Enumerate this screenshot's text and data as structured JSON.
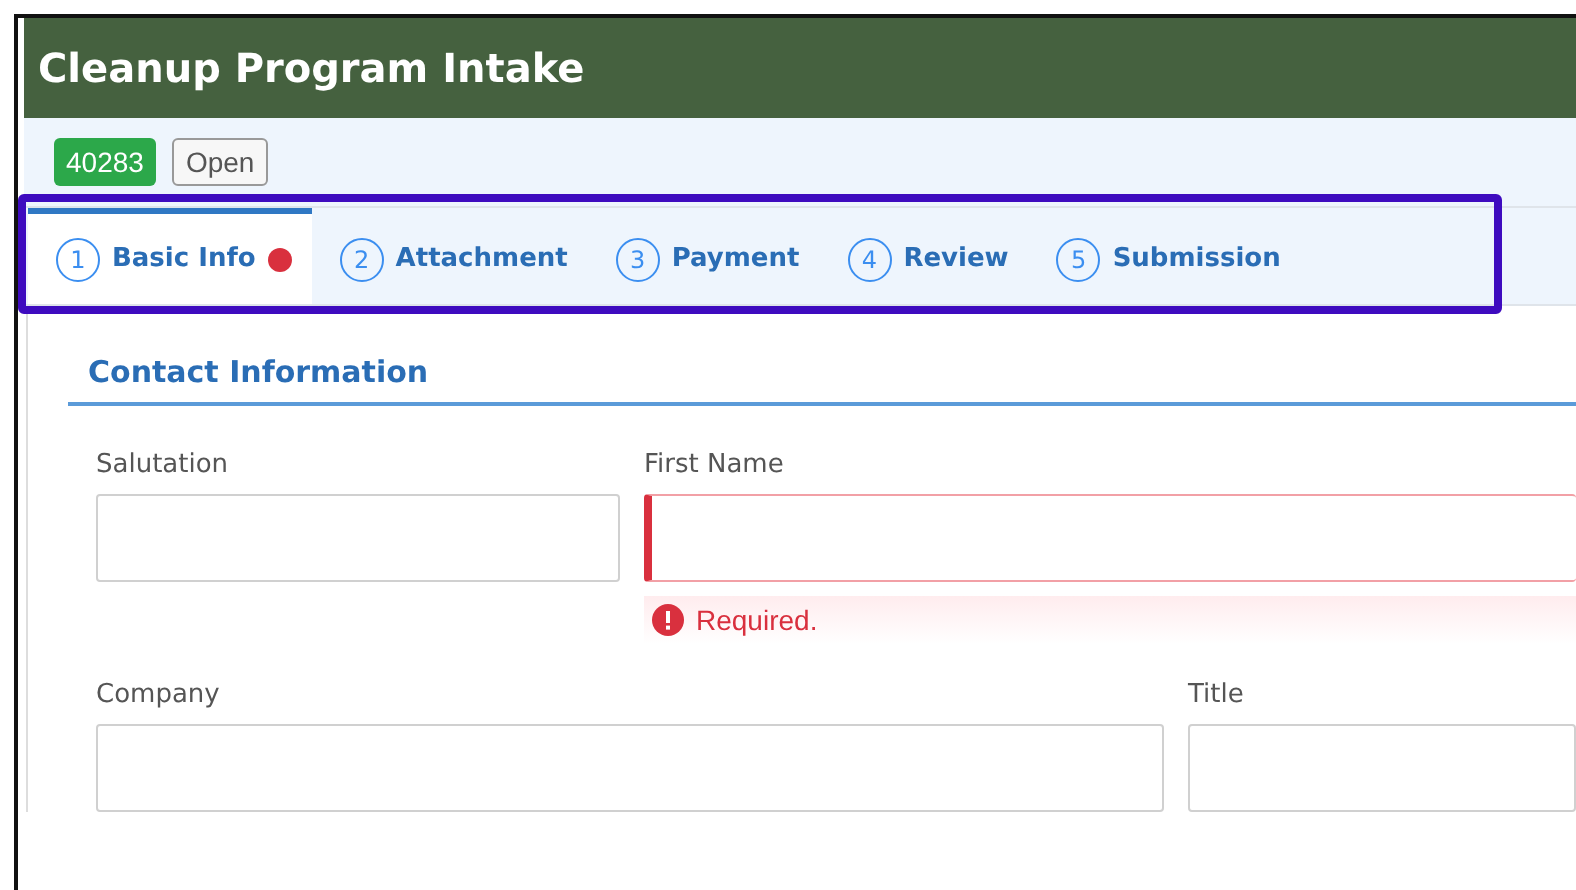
{
  "window": {
    "title": "Cleanup Program Intake"
  },
  "record": {
    "id": "40283",
    "status": "Open"
  },
  "tabs": [
    {
      "number": "1",
      "label": "Basic Info",
      "selected": true,
      "error": true
    },
    {
      "number": "2",
      "label": "Attachment",
      "selected": false,
      "error": false
    },
    {
      "number": "3",
      "label": "Payment",
      "selected": false,
      "error": false
    },
    {
      "number": "4",
      "label": "Review",
      "selected": false,
      "error": false
    },
    {
      "number": "5",
      "label": "Submission",
      "selected": false,
      "error": false
    }
  ],
  "section": {
    "title": "Contact Information"
  },
  "form_rows": [
    [
      {
        "label": "Salutation",
        "invalid": false
      },
      {
        "label": "First Name",
        "invalid": true,
        "error": "Required."
      }
    ],
    [
      {
        "label": "Company",
        "invalid": false
      },
      {
        "label": "Title",
        "invalid": false
      }
    ]
  ]
}
